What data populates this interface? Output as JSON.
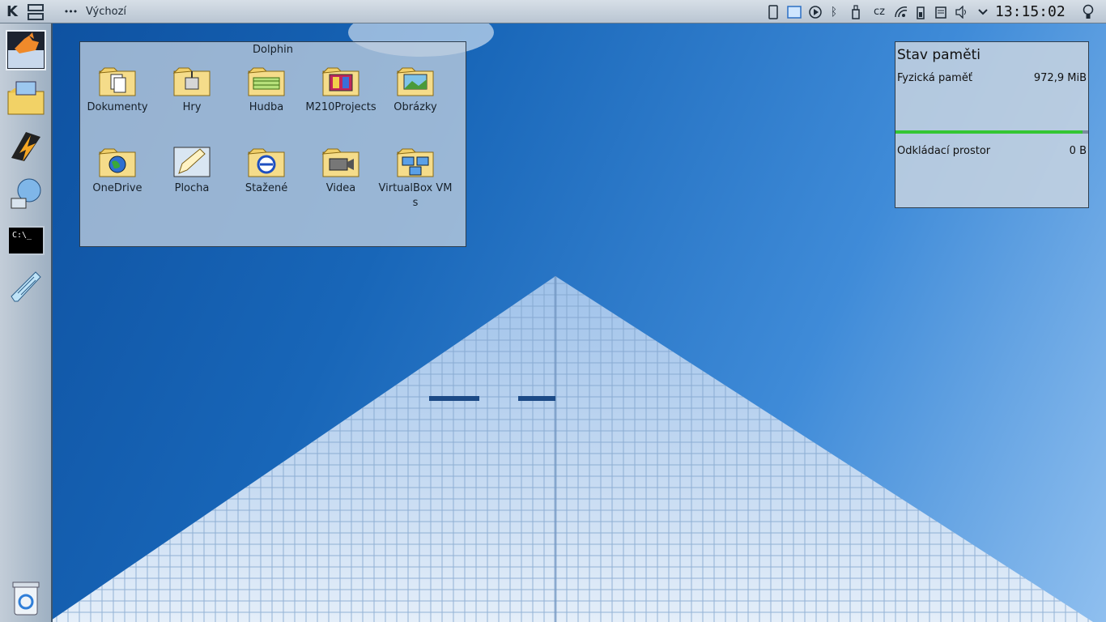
{
  "top_panel": {
    "activity_label": "Výchozí",
    "keyboard_layout": "cz",
    "clock": "13:15:02"
  },
  "dolphin_widget": {
    "title": "Dolphin",
    "items": [
      {
        "label": "Dokumenty",
        "icon": "documents-folder-icon"
      },
      {
        "label": "Hry",
        "icon": "games-folder-icon"
      },
      {
        "label": "Hudba",
        "icon": "music-folder-icon"
      },
      {
        "label": "M210Projects",
        "icon": "projects-folder-icon"
      },
      {
        "label": "Obrázky",
        "icon": "pictures-folder-icon"
      },
      {
        "label": "OneDrive",
        "icon": "onedrive-folder-icon"
      },
      {
        "label": "Plocha",
        "icon": "desktop-folder-icon"
      },
      {
        "label": "Stažené",
        "icon": "downloads-folder-icon"
      },
      {
        "label": "Videa",
        "icon": "videos-folder-icon"
      },
      {
        "label": "VirtualBox VMs",
        "icon": "virtualbox-folder-icon"
      }
    ]
  },
  "memory_widget": {
    "title": "Stav paměti",
    "physical_label": "Fyzická paměť",
    "physical_value": "972,9 MiB",
    "physical_usage_fraction": 0.97,
    "swap_label": "Odkládací prostor",
    "swap_value": "0 B",
    "bar_color": "#34c634"
  },
  "dock": {
    "terminal_prompt": "C:\\_"
  }
}
